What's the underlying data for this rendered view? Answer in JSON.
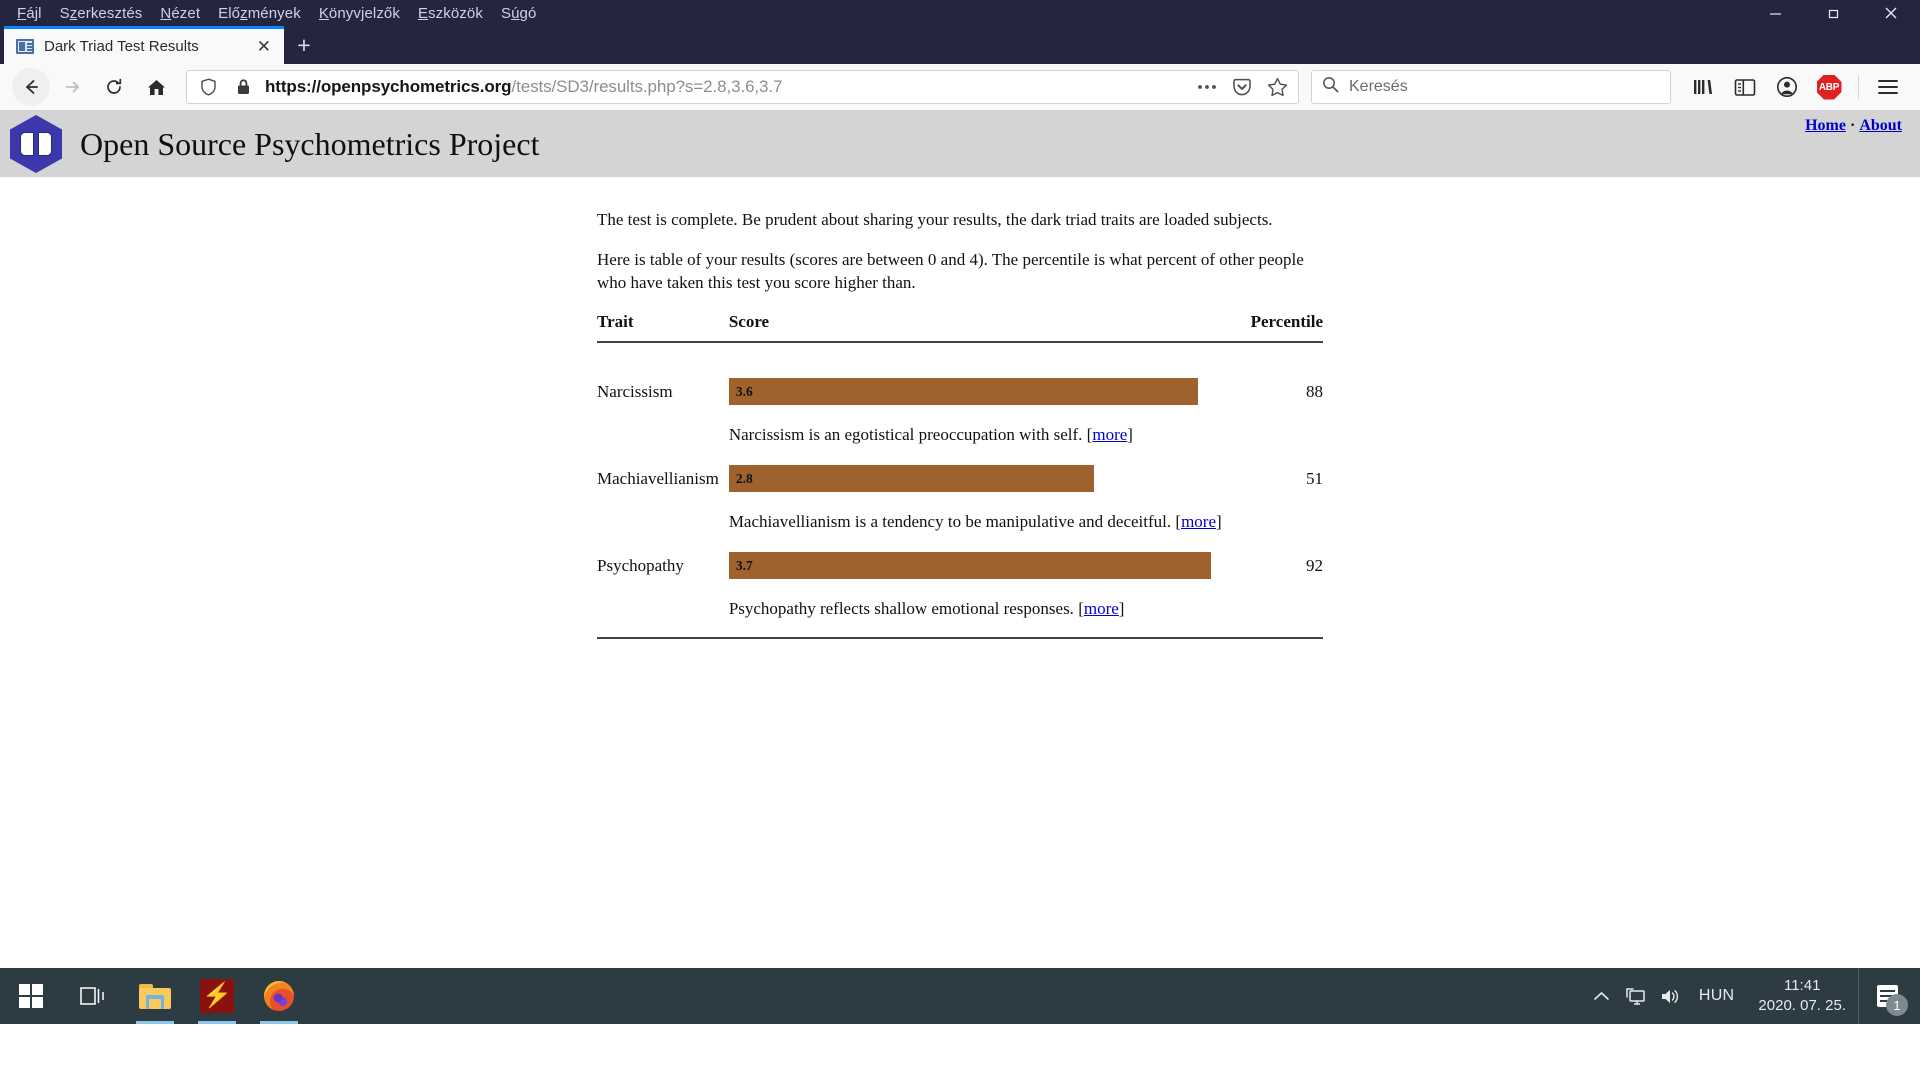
{
  "window": {
    "menus": [
      "Fájl",
      "Szerkesztés",
      "Nézet",
      "Előzmények",
      "Könyvjelzők",
      "Eszközök",
      "Súgó"
    ],
    "minimize": "—",
    "maximize": "❐",
    "close": "✕"
  },
  "browser": {
    "tab": {
      "title": "Dark Triad Test Results",
      "close_label": "✕",
      "favicon_name": "page-favicon"
    },
    "new_tab_label": "+",
    "url": {
      "scheme_host": "https://openpsychometrics.org",
      "path": "/tests/SD3/results.php?s=2.8,3.6,3.7",
      "full": "https://openpsychometrics.org/tests/SD3/results.php?s=2.8,3.6,3.7"
    },
    "search": {
      "placeholder": "Keresés"
    },
    "extension_badge": "ABP"
  },
  "site": {
    "title": "Open Source Psychometrics Project",
    "links": [
      {
        "label": "Home"
      },
      {
        "label": "About"
      }
    ],
    "link_separator": "·",
    "header_bg": "#d4d4d4",
    "logo_color": "#3b38ab"
  },
  "main": {
    "intro": "The test is complete. Be prudent about sharing your results, the dark triad traits are loaded subjects.",
    "explanation": "Here is table of your results (scores are between 0 and 4). The percentile is what percent of other people who have taken this test you score higher than.",
    "columns": [
      "Trait",
      "Score",
      "Percentile"
    ],
    "more_label": "more",
    "bar_color": "#a0622d"
  },
  "chart_data": {
    "type": "bar",
    "title": "Dark Triad Test Results",
    "xlabel": "Score",
    "ylabel": "Trait",
    "xlim": [
      0,
      4
    ],
    "categories": [
      "Narcissism",
      "Machiavellianism",
      "Psychopathy"
    ],
    "values": [
      3.6,
      2.8,
      3.7
    ],
    "value_labels": [
      "3.6",
      "2.8",
      "3.7"
    ],
    "percentiles": [
      88,
      51,
      92
    ],
    "percentile_labels": [
      "88",
      "51",
      "92"
    ],
    "descriptions": [
      "Narcissism is an egotistical preoccupation with self.",
      "Machiavellianism is a tendency to be manipulative and deceitful.",
      "Psychopathy reflects shallow emotional responses."
    ],
    "bar_color": "#a0622d",
    "grid": false,
    "legend": false
  },
  "taskbar": {
    "items": [
      {
        "name": "start-button",
        "label": "Start"
      },
      {
        "name": "task-view-button",
        "label": "Task View"
      },
      {
        "name": "file-explorer-button",
        "label": "File Explorer"
      },
      {
        "name": "bolt-app-button",
        "label": "App"
      },
      {
        "name": "firefox-button",
        "label": "Firefox"
      }
    ],
    "language": "HUN",
    "time": "11:41",
    "date": "2020. 07. 25.",
    "notification_count": "1"
  }
}
